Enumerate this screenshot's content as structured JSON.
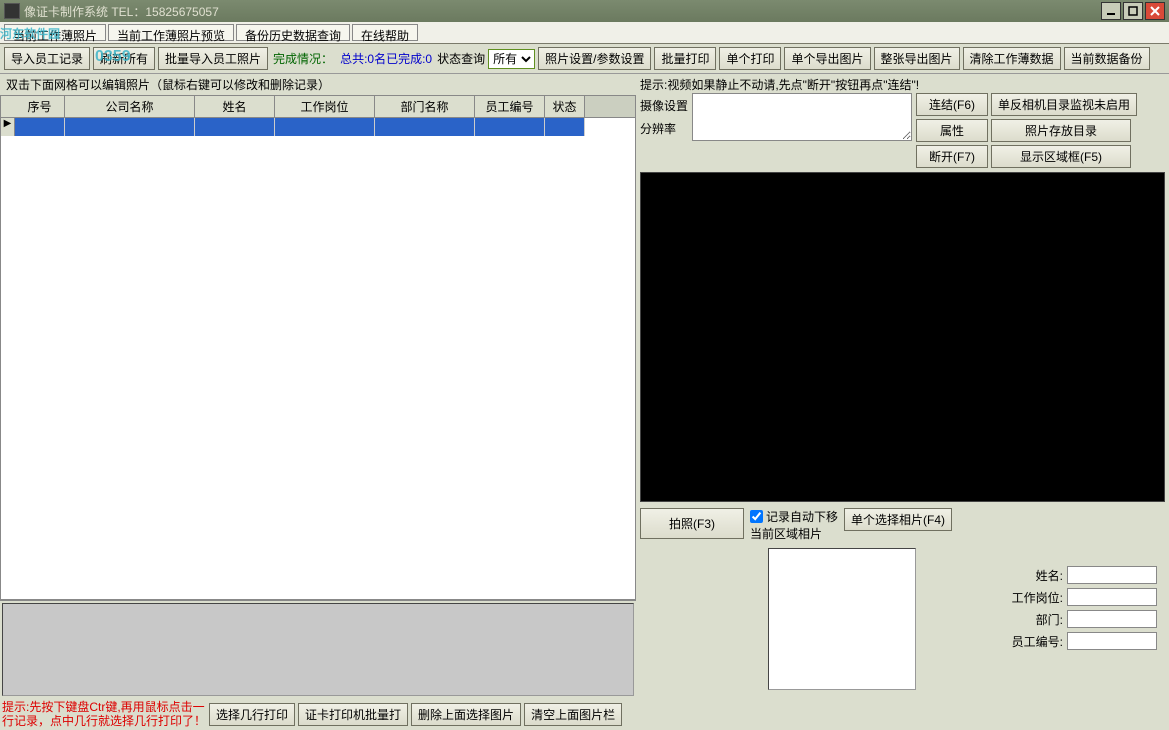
{
  "titlebar": {
    "title": "像证卡制作系统 TEL：15825675057"
  },
  "watermark": {
    "main": "河东软件园",
    "sub": "0359"
  },
  "menubar": {
    "items": [
      "当前工作薄照片",
      "当前工作薄照片预览",
      "备份历史数据查询",
      "在线帮助"
    ]
  },
  "toolbar": {
    "btn_import": "导入员工记录",
    "btn_refresh": "刷新所有",
    "btn_batch_import_photo": "批量导入员工照片",
    "lbl_progress": "完成情况：",
    "lbl_progress_val": "总共:0名已完成:0",
    "lbl_status_query": "状态查询",
    "combo_status": "所有",
    "btn_photo_param": "照片设置/参数设置",
    "btn_batch_print": "批量打印",
    "btn_single_print": "单个打印",
    "btn_single_export": "单个导出图片",
    "btn_batch_export": "整张导出图片",
    "btn_clear_data": "清除工作薄数据",
    "btn_backup_now": "当前数据备份"
  },
  "grid": {
    "hint": "双击下面网格可以编辑照片（鼠标右键可以修改和删除记录）",
    "cols": [
      "序号",
      "公司名称",
      "姓名",
      "工作岗位",
      "部门名称",
      "员工编号",
      "状态"
    ],
    "widths": [
      50,
      130,
      80,
      100,
      100,
      70,
      40
    ]
  },
  "lower_left": {
    "red_hint_l1": "提示:先按下键盘Ctr键,再用鼠标点击一",
    "red_hint_l2": "行记录，点中几行就选择几行打印了！",
    "btn_sel_print": "选择几行打印",
    "btn_card_printer": "证卡打印机批量打",
    "btn_del_sel_img": "删除上面选择图片",
    "btn_clear_img_col": "清空上面图片栏"
  },
  "cam": {
    "hint_top": "提示:视频如果静止不动请,先点\"断开\"按钮再点\"连结\"!",
    "lbl_cam_set": "摄像设置",
    "lbl_res": "分辨率",
    "btn_connect": "连结(F6)",
    "btn_dslr_monitor": "单反相机目录监视未启用",
    "btn_props": "属性",
    "btn_photo_dir": "照片存放目录",
    "btn_disconnect": "断开(F7)",
    "btn_show_area": "显示区域框(F5)",
    "btn_capture": "拍照(F3)",
    "chk_auto_down": "记录自动下移",
    "lbl_cur_area": "当前区域相片",
    "btn_single_sel": "单个选择相片(F4)"
  },
  "form": {
    "lbl_name": "姓名:",
    "lbl_job": "工作岗位:",
    "lbl_dept": "部门:",
    "lbl_emp_no": "员工编号:"
  }
}
